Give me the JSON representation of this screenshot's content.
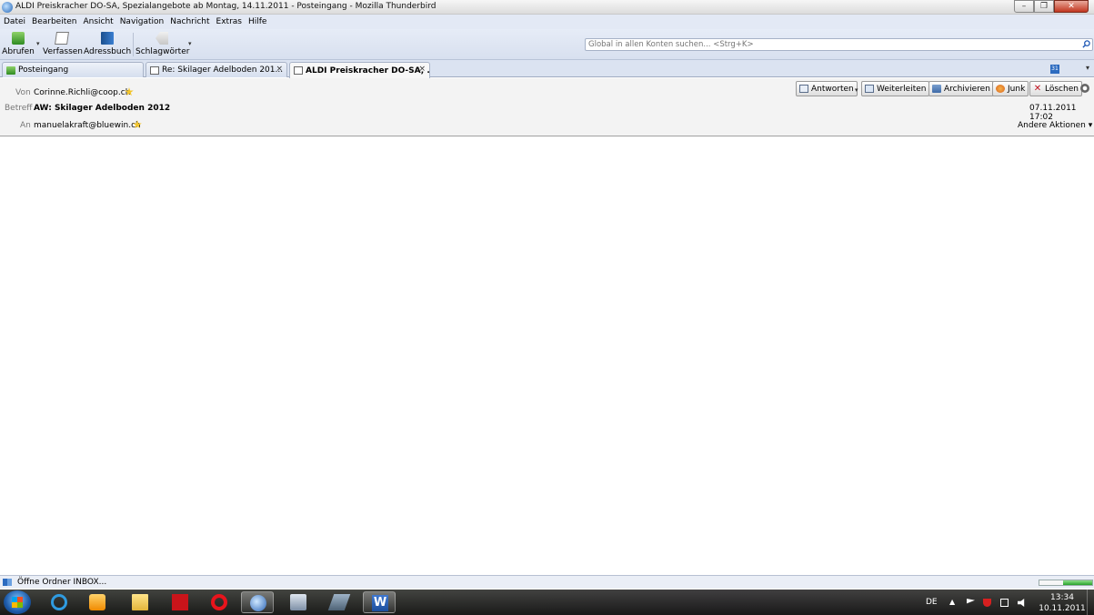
{
  "window": {
    "title": "ALDI Preiskracher DO-SA, Spezialangebote ab Montag, 14.11.2011 - Posteingang - Mozilla Thunderbird",
    "minimize": "–",
    "maximize": "❐",
    "close": "✕"
  },
  "menu": [
    "Datei",
    "Bearbeiten",
    "Ansicht",
    "Navigation",
    "Nachricht",
    "Extras",
    "Hilfe"
  ],
  "toolbar": {
    "get_mail": "Abrufen",
    "write": "Verfassen",
    "address_book": "Adressbuch",
    "tags": "Schlagwörter"
  },
  "search": {
    "placeholder": "Global in allen Konten suchen... <Strg+K>"
  },
  "tabs": [
    {
      "label": "Posteingang",
      "icon": "inbox-icon"
    },
    {
      "label": "Re: Skilager Adelboden 201...",
      "icon": "mail-icon"
    },
    {
      "label": "ALDI Preiskracher DO-SA, ...",
      "icon": "mail-icon",
      "active": true
    }
  ],
  "calendar_badge": "31",
  "message": {
    "from_label": "Von",
    "from": "Corinne.Richli@coop.ch",
    "subject_label": "Betreff",
    "subject": "AW: Skilager Adelboden 2012",
    "to_label": "An",
    "to": "manuelakraft@bluewin.ch",
    "date": "07.11.2011 17:02",
    "other_actions": "Andere Aktionen"
  },
  "actions": {
    "reply": "Antworten",
    "forward": "Weiterleiten",
    "archive": "Archivieren",
    "junk": "Junk",
    "delete": "Löschen"
  },
  "status": {
    "text": "Öffne Ordner INBOX...",
    "progress": 0.55
  },
  "taskbar": {
    "apps": [
      "start",
      "internet-explorer",
      "media-player",
      "explorer",
      "acrobat",
      "opera",
      "thunderbird",
      "camera-app",
      "app",
      "word"
    ],
    "language": "DE",
    "time": "13:34",
    "date": "10.11.2011"
  }
}
